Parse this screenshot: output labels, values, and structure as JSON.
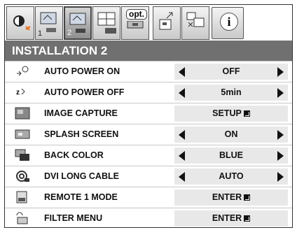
{
  "tabs": [
    {
      "name": "picture",
      "num": ""
    },
    {
      "name": "installation-1",
      "num": "1"
    },
    {
      "name": "installation-2",
      "num": "2"
    },
    {
      "name": "signal",
      "num": ""
    },
    {
      "name": "option",
      "label": "opt."
    },
    {
      "name": "input",
      "num": ""
    },
    {
      "name": "image-adjust",
      "num": ""
    },
    {
      "name": "information",
      "label": "i"
    }
  ],
  "title": "INSTALLATION 2",
  "rows": [
    {
      "label": "AUTO POWER ON",
      "value": "OFF",
      "type": "select"
    },
    {
      "label": "AUTO POWER OFF",
      "value": "5min",
      "type": "select"
    },
    {
      "label": "IMAGE CAPTURE",
      "value": "SETUP",
      "type": "enter"
    },
    {
      "label": "SPLASH SCREEN",
      "value": "ON",
      "type": "select"
    },
    {
      "label": "BACK COLOR",
      "value": "BLUE",
      "type": "select"
    },
    {
      "label": "DVI LONG CABLE",
      "value": "AUTO",
      "type": "select"
    },
    {
      "label": "REMOTE 1 MODE",
      "value": "ENTER",
      "type": "enter"
    },
    {
      "label": "FILTER MENU",
      "value": "ENTER",
      "type": "enter"
    }
  ],
  "icons": [
    "auto-power-on-icon",
    "auto-power-off-icon",
    "image-capture-icon",
    "splash-screen-icon",
    "back-color-icon",
    "dvi-cable-icon",
    "remote-mode-icon",
    "filter-menu-icon"
  ]
}
